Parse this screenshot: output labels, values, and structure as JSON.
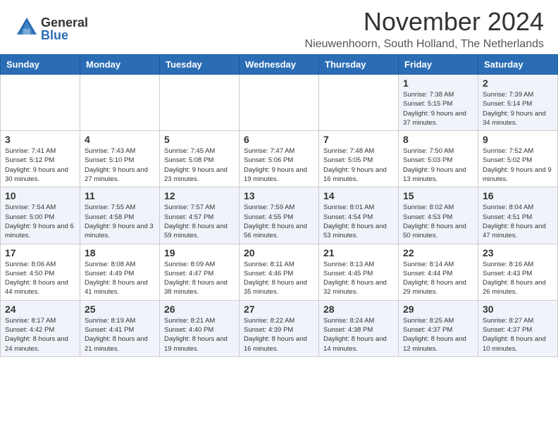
{
  "header": {
    "logo_general": "General",
    "logo_blue": "Blue",
    "title": "November 2024",
    "location": "Nieuwenhoorn, South Holland, The Netherlands"
  },
  "days_of_week": [
    "Sunday",
    "Monday",
    "Tuesday",
    "Wednesday",
    "Thursday",
    "Friday",
    "Saturday"
  ],
  "weeks": [
    [
      {
        "day": "",
        "info": ""
      },
      {
        "day": "",
        "info": ""
      },
      {
        "day": "",
        "info": ""
      },
      {
        "day": "",
        "info": ""
      },
      {
        "day": "",
        "info": ""
      },
      {
        "day": "1",
        "info": "Sunrise: 7:38 AM\nSunset: 5:15 PM\nDaylight: 9 hours and 37 minutes."
      },
      {
        "day": "2",
        "info": "Sunrise: 7:39 AM\nSunset: 5:14 PM\nDaylight: 9 hours and 34 minutes."
      }
    ],
    [
      {
        "day": "3",
        "info": "Sunrise: 7:41 AM\nSunset: 5:12 PM\nDaylight: 9 hours and 30 minutes."
      },
      {
        "day": "4",
        "info": "Sunrise: 7:43 AM\nSunset: 5:10 PM\nDaylight: 9 hours and 27 minutes."
      },
      {
        "day": "5",
        "info": "Sunrise: 7:45 AM\nSunset: 5:08 PM\nDaylight: 9 hours and 23 minutes."
      },
      {
        "day": "6",
        "info": "Sunrise: 7:47 AM\nSunset: 5:06 PM\nDaylight: 9 hours and 19 minutes."
      },
      {
        "day": "7",
        "info": "Sunrise: 7:48 AM\nSunset: 5:05 PM\nDaylight: 9 hours and 16 minutes."
      },
      {
        "day": "8",
        "info": "Sunrise: 7:50 AM\nSunset: 5:03 PM\nDaylight: 9 hours and 13 minutes."
      },
      {
        "day": "9",
        "info": "Sunrise: 7:52 AM\nSunset: 5:02 PM\nDaylight: 9 hours and 9 minutes."
      }
    ],
    [
      {
        "day": "10",
        "info": "Sunrise: 7:54 AM\nSunset: 5:00 PM\nDaylight: 9 hours and 6 minutes."
      },
      {
        "day": "11",
        "info": "Sunrise: 7:55 AM\nSunset: 4:58 PM\nDaylight: 9 hours and 3 minutes."
      },
      {
        "day": "12",
        "info": "Sunrise: 7:57 AM\nSunset: 4:57 PM\nDaylight: 8 hours and 59 minutes."
      },
      {
        "day": "13",
        "info": "Sunrise: 7:59 AM\nSunset: 4:55 PM\nDaylight: 8 hours and 56 minutes."
      },
      {
        "day": "14",
        "info": "Sunrise: 8:01 AM\nSunset: 4:54 PM\nDaylight: 8 hours and 53 minutes."
      },
      {
        "day": "15",
        "info": "Sunrise: 8:02 AM\nSunset: 4:53 PM\nDaylight: 8 hours and 50 minutes."
      },
      {
        "day": "16",
        "info": "Sunrise: 8:04 AM\nSunset: 4:51 PM\nDaylight: 8 hours and 47 minutes."
      }
    ],
    [
      {
        "day": "17",
        "info": "Sunrise: 8:06 AM\nSunset: 4:50 PM\nDaylight: 8 hours and 44 minutes."
      },
      {
        "day": "18",
        "info": "Sunrise: 8:08 AM\nSunset: 4:49 PM\nDaylight: 8 hours and 41 minutes."
      },
      {
        "day": "19",
        "info": "Sunrise: 8:09 AM\nSunset: 4:47 PM\nDaylight: 8 hours and 38 minutes."
      },
      {
        "day": "20",
        "info": "Sunrise: 8:11 AM\nSunset: 4:46 PM\nDaylight: 8 hours and 35 minutes."
      },
      {
        "day": "21",
        "info": "Sunrise: 8:13 AM\nSunset: 4:45 PM\nDaylight: 8 hours and 32 minutes."
      },
      {
        "day": "22",
        "info": "Sunrise: 8:14 AM\nSunset: 4:44 PM\nDaylight: 8 hours and 29 minutes."
      },
      {
        "day": "23",
        "info": "Sunrise: 8:16 AM\nSunset: 4:43 PM\nDaylight: 8 hours and 26 minutes."
      }
    ],
    [
      {
        "day": "24",
        "info": "Sunrise: 8:17 AM\nSunset: 4:42 PM\nDaylight: 8 hours and 24 minutes."
      },
      {
        "day": "25",
        "info": "Sunrise: 8:19 AM\nSunset: 4:41 PM\nDaylight: 8 hours and 21 minutes."
      },
      {
        "day": "26",
        "info": "Sunrise: 8:21 AM\nSunset: 4:40 PM\nDaylight: 8 hours and 19 minutes."
      },
      {
        "day": "27",
        "info": "Sunrise: 8:22 AM\nSunset: 4:39 PM\nDaylight: 8 hours and 16 minutes."
      },
      {
        "day": "28",
        "info": "Sunrise: 8:24 AM\nSunset: 4:38 PM\nDaylight: 8 hours and 14 minutes."
      },
      {
        "day": "29",
        "info": "Sunrise: 8:25 AM\nSunset: 4:37 PM\nDaylight: 8 hours and 12 minutes."
      },
      {
        "day": "30",
        "info": "Sunrise: 8:27 AM\nSunset: 4:37 PM\nDaylight: 8 hours and 10 minutes."
      }
    ]
  ]
}
